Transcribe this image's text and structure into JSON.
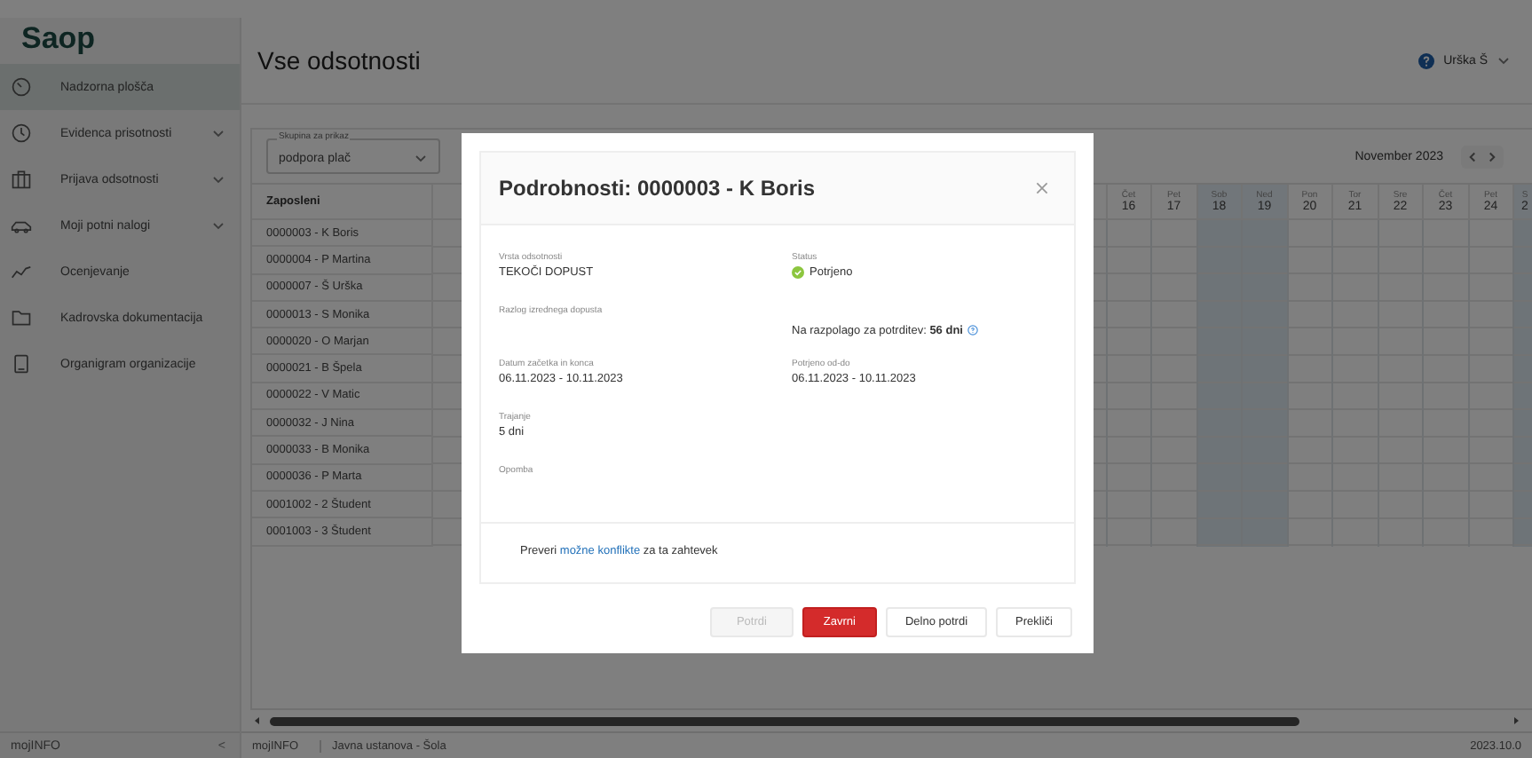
{
  "sidebar": {
    "logo": "Saop",
    "items": [
      {
        "label": "Nadzorna plošča",
        "selected": true,
        "expandable": false
      },
      {
        "label": "Evidenca prisotnosti",
        "selected": false,
        "expandable": true
      },
      {
        "label": "Prijava odsotnosti",
        "selected": false,
        "expandable": true
      },
      {
        "label": "Moji potni nalogi",
        "selected": false,
        "expandable": true
      },
      {
        "label": "Ocenjevanje",
        "selected": false,
        "expandable": false
      },
      {
        "label": "Kadrovska dokumentacija",
        "selected": false,
        "expandable": false
      },
      {
        "label": "Organigram organizacije",
        "selected": false,
        "expandable": false
      }
    ],
    "footer": {
      "label": "mojINFO",
      "collapse": "<"
    }
  },
  "header": {
    "title": "Vse odsotnosti",
    "user": "Urška Š"
  },
  "filter": {
    "label": "Skupina za prikaz",
    "value": "podpora plač"
  },
  "calendar": {
    "month": "November 2023",
    "days": [
      {
        "day": "Čet",
        "date": "16",
        "weekend": false
      },
      {
        "day": "Pet",
        "date": "17",
        "weekend": false
      },
      {
        "day": "Sob",
        "date": "18",
        "weekend": true
      },
      {
        "day": "Ned",
        "date": "19",
        "weekend": true
      },
      {
        "day": "Pon",
        "date": "20",
        "weekend": false
      },
      {
        "day": "Tor",
        "date": "21",
        "weekend": false
      },
      {
        "day": "Sre",
        "date": "22",
        "weekend": false
      },
      {
        "day": "Čet",
        "date": "23",
        "weekend": false
      },
      {
        "day": "Pet",
        "date": "24",
        "weekend": false
      },
      {
        "day": "S",
        "date": "2",
        "weekend": true
      }
    ]
  },
  "table": {
    "column": "Zaposleni",
    "rows": [
      "0000003 - K Boris",
      "0000004 - P Martina",
      "0000007 - Š Urška",
      "0000013 - S Monika",
      "0000020 - O Marjan",
      "0000021 - B Špela",
      "0000022 - V Matic",
      "0000032 - J Nina",
      "0000033 - B Monika",
      "0000036 - P Marta",
      "0001002 - 2 Študent",
      "0001003 - 3 Študent"
    ]
  },
  "status_bar": {
    "app": "mojINFO",
    "organization": "Javna ustanova - Šola",
    "version": "2023.10.0"
  },
  "modal": {
    "title": "Podrobnosti: 0000003 - K Boris",
    "fields": {
      "type": {
        "label": "Vrsta odsotnosti",
        "value": "TEKOČI DOPUST"
      },
      "status": {
        "label": "Status",
        "value": "Potrjeno",
        "color": "#8cc63f"
      },
      "reason": {
        "label": "Razlog izrednega dopusta"
      },
      "available": "Na razpolago za potrditev: **56 dni**",
      "dates": {
        "label": "Datum začetka in konca",
        "value": "06.11.2023 - 10.11.2023"
      },
      "confirmed": {
        "label": "Potrjeno od-do",
        "value": "06.11.2023 - 10.11.2023"
      },
      "duration": {
        "label": "Trajanje",
        "value": "5 dni"
      },
      "note": {
        "label": "Opomba"
      }
    },
    "conflicts": {
      "before": "Preveri",
      "link": "možne konflikte",
      "after": "za ta zahtevek"
    },
    "buttons": [
      {
        "label": "Potrdi",
        "kind": "default",
        "disabled": true
      },
      {
        "label": "Zavrni",
        "kind": "danger",
        "disabled": false
      },
      {
        "label": "Delno potrdi",
        "kind": "default",
        "disabled": false
      },
      {
        "label": "Prekliči",
        "kind": "default",
        "disabled": false
      }
    ]
  }
}
